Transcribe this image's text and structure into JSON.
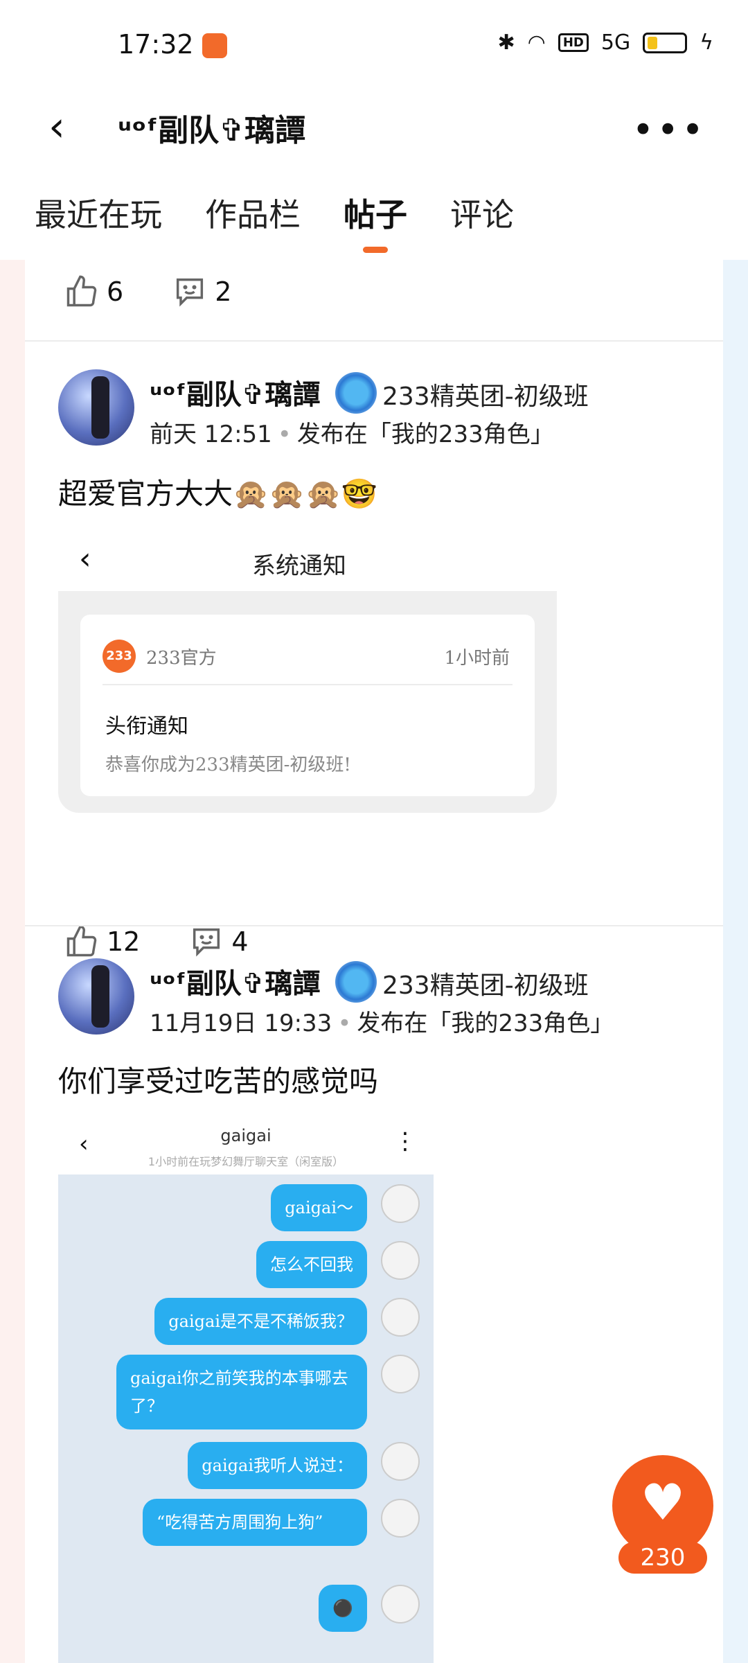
{
  "status": {
    "time": "17:32",
    "icons": [
      "app-icon",
      "bluetooth-icon",
      "wifi-icon",
      "hd-icon",
      "5g-signal-icon",
      "battery-icon",
      "charging-icon"
    ],
    "hd": "HD",
    "network": "5G"
  },
  "header": {
    "title": "ᵘᵒᶠ副队✞璃譚",
    "back_icon": "back-icon",
    "more_icon": "more-icon"
  },
  "tabs": [
    {
      "label": "最近在玩",
      "active": false
    },
    {
      "label": "作品栏",
      "active": false
    },
    {
      "label": "帖子",
      "active": true
    },
    {
      "label": "评论",
      "active": false
    }
  ],
  "top_actions": {
    "likes": "6",
    "comments": "2"
  },
  "posts": [
    {
      "author": "ᵘᵒᶠ副队✞璃譚",
      "badge": "233精英团-初级班",
      "time": "前天 12:51",
      "published_in": "发布在「我的233角色」",
      "text": "超爱官方大大🙊🙊🙊🤓",
      "image": {
        "title": "系统通知",
        "logo": "233",
        "source": "233官方",
        "time": "1小时前",
        "heading": "头衔通知",
        "message": "恭喜你成为233精英团-初级班!"
      },
      "likes": "12",
      "comments": "4"
    },
    {
      "author": "ᵘᵒᶠ副队✞璃譚",
      "badge": "233精英团-初级班",
      "time": "11月19日 19:33",
      "published_in": "发布在「我的233角色」",
      "text": "你们享受过吃苦的感觉吗",
      "image": {
        "name": "gaigai",
        "subtitle": "1小时前在玩梦幻舞厅聊天室（闲室版）",
        "messages": [
          "gaigai～",
          "怎么不回我",
          "gaigai是不是不稀饭我？",
          "gaigai你之前笑我的本事哪去了？",
          "gaigai我听人说过：",
          "“吃得苦方周围狗上狗”",
          "⚫"
        ]
      }
    }
  ],
  "fab": {
    "icon": "heart-icon",
    "count": "230"
  },
  "colors": {
    "accent": "#f25a1e",
    "bubble": "#29aef0"
  }
}
